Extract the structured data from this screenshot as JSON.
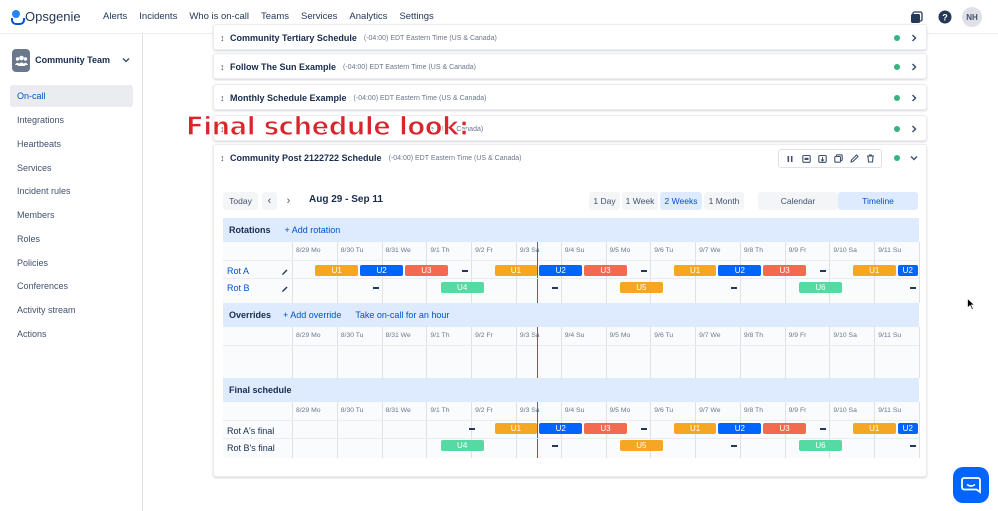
{
  "nav": {
    "logo": "Opsgenie",
    "links": [
      "Alerts",
      "Incidents",
      "Who is on-call",
      "Teams",
      "Services",
      "Analytics",
      "Settings"
    ],
    "avatar": "NH"
  },
  "sidebar": {
    "team": "Community Team",
    "items": [
      "On-call",
      "Integrations",
      "Heartbeats",
      "Services",
      "Incident rules",
      "Members",
      "Roles",
      "Policies",
      "Conferences",
      "Activity stream",
      "Actions"
    ],
    "active_index": 0
  },
  "schedules": [
    {
      "name": "Community Tertiary Schedule",
      "tz": "(-04:00) EDT Eastern Time (US & Canada)"
    },
    {
      "name": "Follow The Sun Example",
      "tz": "(-04:00) EDT Eastern Time (US & Canada)"
    },
    {
      "name": "Monthly Schedule Example",
      "tz": "(-04:00) EDT Eastern Time (US & Canada)"
    },
    {
      "name": "t",
      "tz": "ne (US & Canada)"
    },
    {
      "name": "Community Post 2122722 Schedule",
      "tz": "(-04:00) EDT Eastern Time (US & Canada)"
    }
  ],
  "overlay": "Final schedule look:",
  "controls": {
    "today": "Today",
    "prev": "‹",
    "next": "›",
    "date_range": "Aug 29 - Sep 11",
    "ranges": [
      "1 Day",
      "1 Week",
      "2 Weeks",
      "1 Month"
    ],
    "selected_range": "2 Weeks",
    "views": [
      "Calendar",
      "Timeline"
    ],
    "selected_view": "Timeline"
  },
  "timeline": {
    "days": [
      "8/29 Mo",
      "8/30 Tu",
      "8/31 We",
      "9/1 Th",
      "9/2 Fr",
      "9/3 Sa",
      "9/4 Su",
      "9/5 Mo",
      "9/6 Tu",
      "9/7 We",
      "9/8 Th",
      "9/9 Fr",
      "9/10 Sa",
      "9/11 Su"
    ],
    "today_fraction": 0.39,
    "rotations": {
      "title": "Rotations",
      "add": "+ Add rotation",
      "rows": [
        {
          "label": "Rot A",
          "segments": [
            {
              "text": "U1",
              "color": "#f5a623",
              "start": 0.5,
              "end": 1.5
            },
            {
              "text": "U2",
              "color": "#0065ff",
              "start": 1.5,
              "end": 2.5
            },
            {
              "text": "U3",
              "color": "#f26b4f",
              "start": 2.5,
              "end": 3.5
            },
            {
              "text": "U1",
              "color": "#f5a623",
              "start": 4.5,
              "end": 5.5
            },
            {
              "text": "U2",
              "color": "#0065ff",
              "start": 5.5,
              "end": 6.5
            },
            {
              "text": "U3",
              "color": "#f26b4f",
              "start": 6.5,
              "end": 7.5
            },
            {
              "text": "U1",
              "color": "#f5a623",
              "start": 8.5,
              "end": 9.5
            },
            {
              "text": "U2",
              "color": "#0065ff",
              "start": 9.5,
              "end": 10.5
            },
            {
              "text": "U3",
              "color": "#f26b4f",
              "start": 10.5,
              "end": 11.5
            },
            {
              "text": "U1",
              "color": "#f5a623",
              "start": 12.5,
              "end": 13.5
            },
            {
              "text": "U2",
              "color": "#0065ff",
              "start": 13.5,
              "end": 14
            }
          ],
          "dashes": [
            3.8,
            7.8,
            11.8
          ]
        },
        {
          "label": "Rot B",
          "segments": [
            {
              "text": "U4",
              "color": "#57d9a3",
              "start": 3.3,
              "end": 4.3
            },
            {
              "text": "U5",
              "color": "#f5a623",
              "start": 7.3,
              "end": 8.3
            },
            {
              "text": "U6",
              "color": "#57d9a3",
              "start": 11.3,
              "end": 12.3
            }
          ],
          "dashes": [
            1.8,
            5.8,
            9.8,
            13.8
          ]
        }
      ]
    },
    "overrides": {
      "title": "Overrides",
      "add": "+ Add override",
      "take": "Take on-call for an hour"
    },
    "final": {
      "title": "Final schedule",
      "rows": [
        {
          "label": "Rot A's final",
          "segments": [
            {
              "text": "U1",
              "color": "#f5a623",
              "start": 4.5,
              "end": 5.5
            },
            {
              "text": "U2",
              "color": "#0065ff",
              "start": 5.5,
              "end": 6.5
            },
            {
              "text": "U3",
              "color": "#f26b4f",
              "start": 6.5,
              "end": 7.5
            },
            {
              "text": "U1",
              "color": "#f5a623",
              "start": 8.5,
              "end": 9.5
            },
            {
              "text": "U2",
              "color": "#0065ff",
              "start": 9.5,
              "end": 10.5
            },
            {
              "text": "U3",
              "color": "#f26b4f",
              "start": 10.5,
              "end": 11.5
            },
            {
              "text": "U1",
              "color": "#f5a623",
              "start": 12.5,
              "end": 13.5
            },
            {
              "text": "U2",
              "color": "#0065ff",
              "start": 13.5,
              "end": 14
            }
          ],
          "dashes": [
            3.95,
            7.8,
            11.8
          ]
        },
        {
          "label": "Rot B's final",
          "segments": [
            {
              "text": "U4",
              "color": "#57d9a3",
              "start": 3.3,
              "end": 4.3
            },
            {
              "text": "U5",
              "color": "#f5a623",
              "start": 7.3,
              "end": 8.3
            },
            {
              "text": "U6",
              "color": "#57d9a3",
              "start": 11.3,
              "end": 12.3
            }
          ],
          "dashes": [
            5.8,
            9.8,
            13.8
          ]
        }
      ]
    }
  }
}
